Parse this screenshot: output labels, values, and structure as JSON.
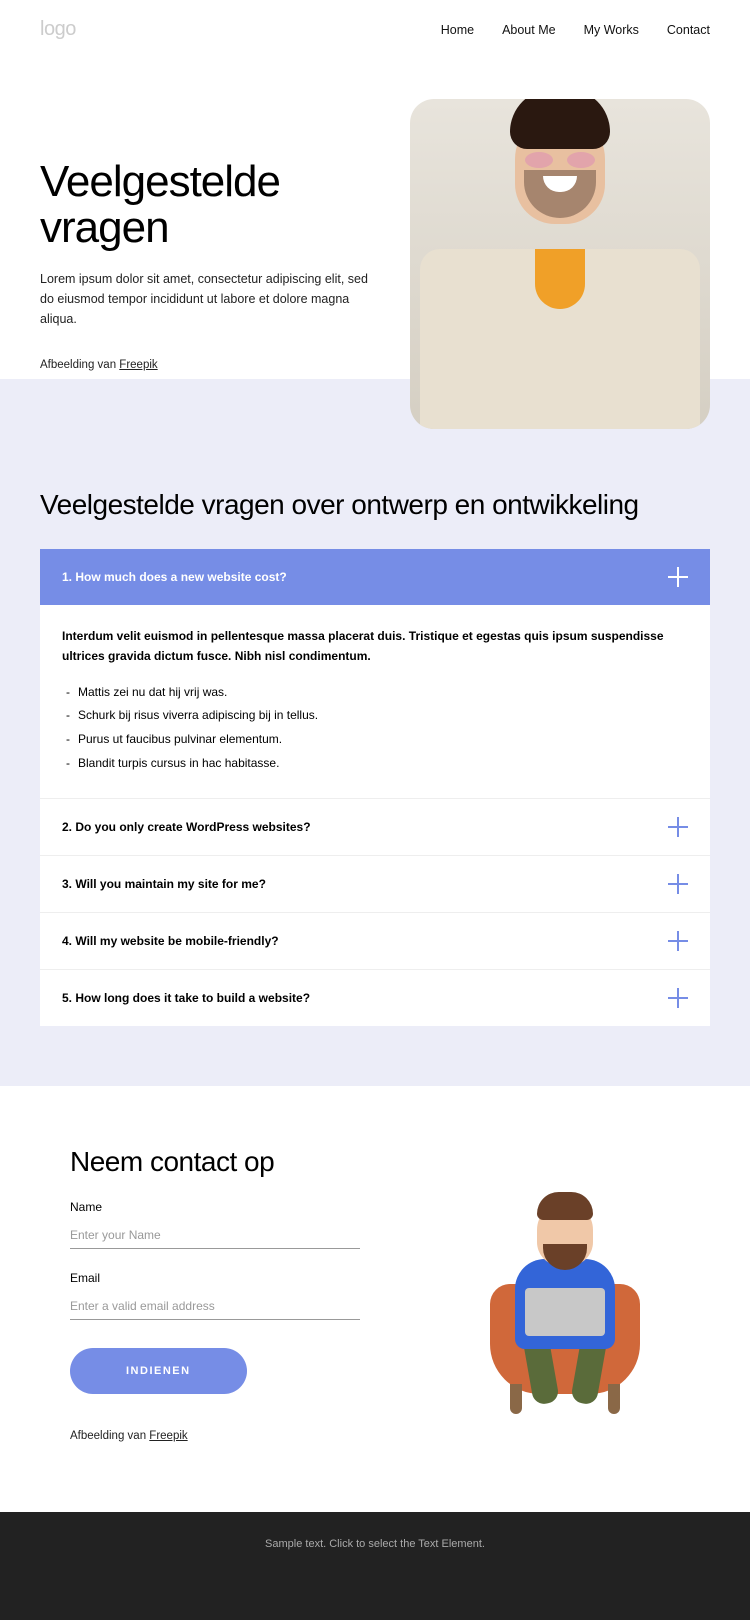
{
  "header": {
    "logo": "logo",
    "nav": [
      "Home",
      "About Me",
      "My Works",
      "Contact"
    ]
  },
  "hero": {
    "title": "Veelgestelde vragen",
    "desc": "Lorem ipsum dolor sit amet, consectetur adipiscing elit, sed do eiusmod tempor incididunt ut labore et dolore magna aliqua.",
    "credit_prefix": "Afbeelding van ",
    "credit_link": "Freepik"
  },
  "faq": {
    "title": "Veelgestelde vragen over ontwerp en ontwikkeling",
    "items": [
      {
        "q": "1. How much does a new website cost?",
        "open": true,
        "intro": "Interdum velit euismod in pellentesque massa placerat duis. Tristique et egestas quis ipsum suspendisse ultrices gravida dictum fusce. Nibh nisl condimentum.",
        "bullets": [
          "Mattis zei nu dat hij vrij was.",
          "Schurk bij risus viverra adipiscing bij in tellus.",
          "Purus ut faucibus pulvinar elementum.",
          "Blandit turpis cursus in hac habitasse."
        ]
      },
      {
        "q": "2. Do you only create WordPress websites?",
        "open": false
      },
      {
        "q": "3. Will you maintain my site for me?",
        "open": false
      },
      {
        "q": "4. Will my website be mobile-friendly?",
        "open": false
      },
      {
        "q": "5. How long does it take to build a website?",
        "open": false
      }
    ]
  },
  "contact": {
    "title": "Neem contact op",
    "name_label": "Name",
    "name_placeholder": "Enter your Name",
    "email_label": "Email",
    "email_placeholder": "Enter a valid email address",
    "submit": "INDIENEN",
    "credit_prefix": "Afbeelding van ",
    "credit_link": "Freepik"
  },
  "footer": {
    "text": "Sample text. Click to select the Text Element."
  }
}
